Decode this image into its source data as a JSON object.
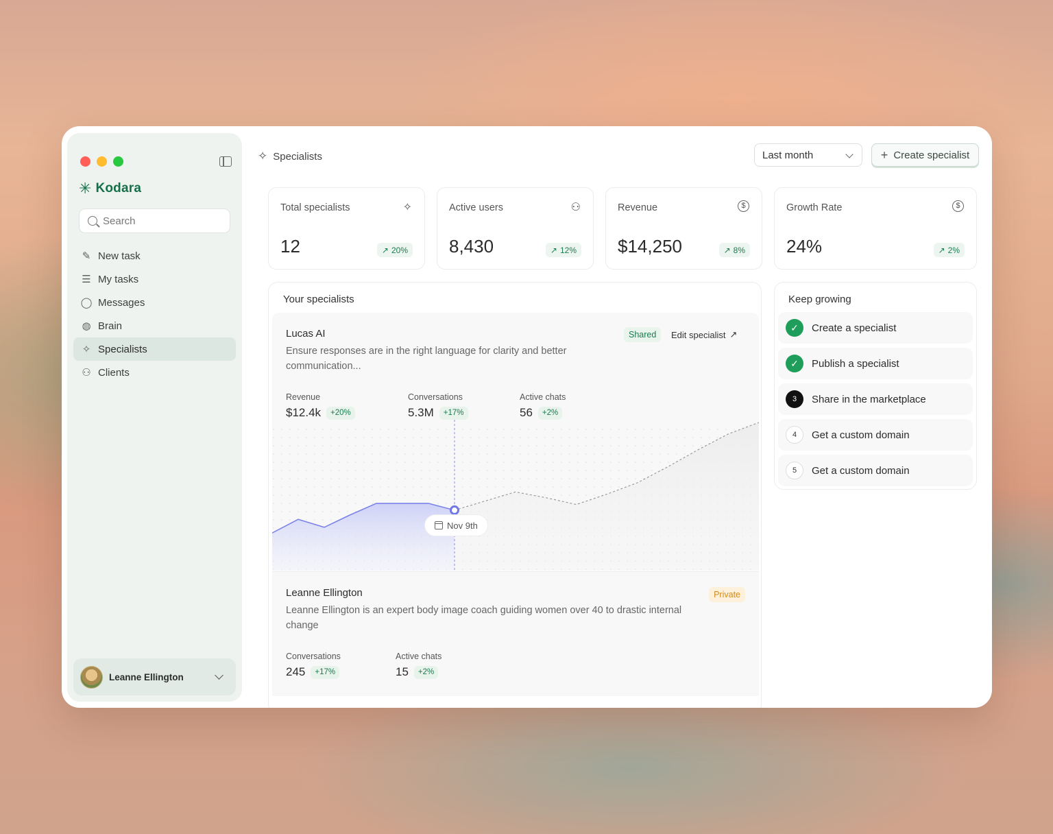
{
  "app": {
    "logo_text": "Kodara",
    "search_placeholder": "Search",
    "nav": [
      {
        "label": "New task",
        "icon": "pen-sparkle-icon"
      },
      {
        "label": "My tasks",
        "icon": "tasks-icon"
      },
      {
        "label": "Messages",
        "icon": "chat-bubble-icon"
      },
      {
        "label": "Brain",
        "icon": "brain-icon"
      },
      {
        "label": "Specialists",
        "icon": "sparkle-icon",
        "active": true
      },
      {
        "label": "Clients",
        "icon": "users-icon"
      }
    ],
    "user": {
      "name": "Leanne Ellington"
    }
  },
  "header": {
    "title": "Specialists",
    "period_select": "Last month",
    "create_button": "Create specialist"
  },
  "stats": [
    {
      "label": "Total specialists",
      "value": "12",
      "change": "20%",
      "icon": "sparkle-icon"
    },
    {
      "label": "Active users",
      "value": "8,430",
      "change": "12%",
      "icon": "users-icon"
    },
    {
      "label": "Revenue",
      "value": "$14,250",
      "change": "8%",
      "icon": "dollar-circle-icon"
    },
    {
      "label": "Growth Rate",
      "value": "24%",
      "change": "2%",
      "icon": "dollar-circle-icon"
    }
  ],
  "specialists_panel": {
    "title": "Your specialists",
    "items": [
      {
        "name": "Lucas AI",
        "badge": "Shared",
        "edit_label": "Edit specialist",
        "description": "Ensure responses are in the right language for clarity and better communication...",
        "metrics": [
          {
            "label": "Revenue",
            "value": "$12.4k",
            "change": "+20%"
          },
          {
            "label": "Conversations",
            "value": "5.3M",
            "change": "+17%"
          },
          {
            "label": "Active chats",
            "value": "56",
            "change": "+2%"
          }
        ],
        "chart_date": "Nov 9th"
      },
      {
        "name": "Leanne Ellington",
        "badge": "Private",
        "description": "Leanne Ellington is an expert body image coach guiding women over 40 to drastic internal change",
        "metrics": [
          {
            "label": "Conversations",
            "value": "245",
            "change": "+17%"
          },
          {
            "label": "Active chats",
            "value": "15",
            "change": "+2%"
          }
        ]
      }
    ]
  },
  "chart_data": {
    "type": "area",
    "title": "",
    "xlabel": "",
    "ylabel": "",
    "highlight_label": "Nov 9th",
    "series": [
      {
        "values": [
          0.27,
          0.39,
          0.32,
          0.43,
          0.53,
          0.53,
          0.53,
          0.47
        ],
        "style": "solid"
      },
      {
        "values": [
          0.47,
          0.55,
          0.63,
          0.58,
          0.52,
          0.61,
          0.71,
          0.85,
          1.0,
          1.14,
          1.24
        ],
        "style": "dashed"
      }
    ],
    "colors": {
      "actual": "#7b83e8",
      "projection": "#9a9a9a"
    },
    "grid": true
  },
  "keep_growing": {
    "title": "Keep growing",
    "steps": [
      {
        "label": "Create a specialist",
        "status": "done",
        "marker": "✓"
      },
      {
        "label": "Publish a specialist",
        "status": "done",
        "marker": "✓"
      },
      {
        "label": "Share in the marketplace",
        "status": "current",
        "marker": "3"
      },
      {
        "label": "Get a custom domain",
        "status": "todo",
        "marker": "4"
      },
      {
        "label": "Get a custom domain",
        "status": "todo",
        "marker": "5"
      }
    ]
  }
}
